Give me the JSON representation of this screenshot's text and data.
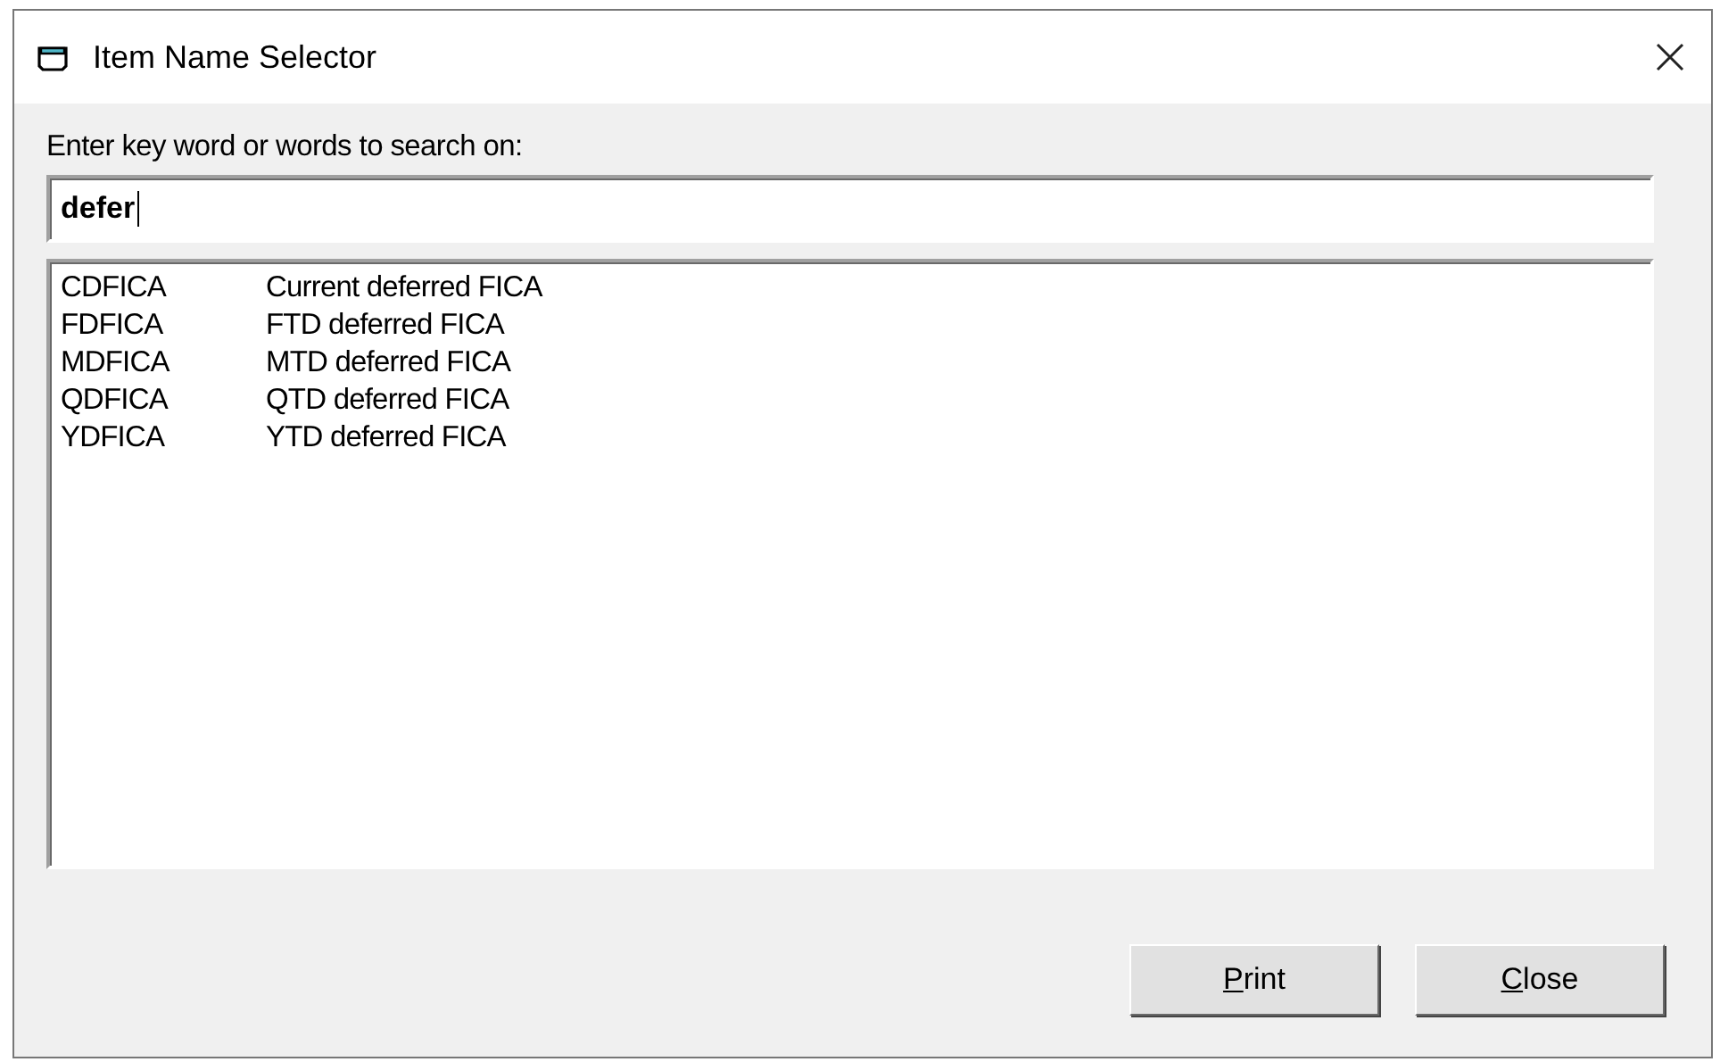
{
  "window": {
    "title": "Item Name Selector"
  },
  "search": {
    "label": "Enter key word or words to search on:",
    "value": "defer"
  },
  "results": [
    {
      "code": "CDFICA",
      "description": "Current deferred FICA"
    },
    {
      "code": "FDFICA",
      "description": "FTD deferred FICA"
    },
    {
      "code": "MDFICA",
      "description": "MTD deferred FICA"
    },
    {
      "code": "QDFICA",
      "description": "QTD deferred FICA"
    },
    {
      "code": "YDFICA",
      "description": "YTD deferred FICA"
    }
  ],
  "buttons": [
    "Print",
    "Close"
  ]
}
